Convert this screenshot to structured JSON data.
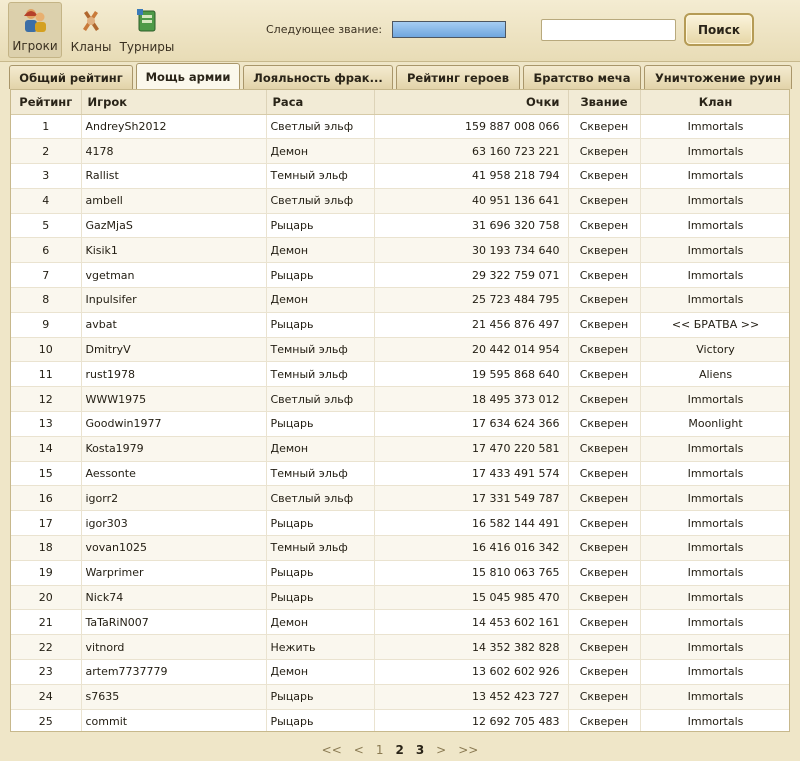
{
  "nav": {
    "players": "Игроки",
    "clans": "Кланы",
    "tournaments": "Турниры"
  },
  "rank": {
    "label": "Следующее звание:",
    "progress": 1.0
  },
  "search": {
    "value": "",
    "button": "Поиск"
  },
  "tabs": [
    "Общий рейтинг",
    "Мощь армии",
    "Лояльность фрак...",
    "Рейтинг героев",
    "Братство меча",
    "Уничтожение руин"
  ],
  "active_tab": 1,
  "columns": {
    "rank": "Рейтинг",
    "player": "Игрок",
    "race": "Раса",
    "points": "Очки",
    "title": "Звание",
    "clan": "Клан"
  },
  "rows": [
    [
      "1",
      "AndreySh2012",
      "Светлый эльф",
      "159 887 008 066",
      "Скверен",
      "Immortals"
    ],
    [
      "2",
      "4178",
      "Демон",
      "63 160 723 221",
      "Скверен",
      "Immortals"
    ],
    [
      "3",
      "Rallist",
      "Темный эльф",
      "41 958 218 794",
      "Скверен",
      "Immortals"
    ],
    [
      "4",
      "ambell",
      "Светлый эльф",
      "40 951 136 641",
      "Скверен",
      "Immortals"
    ],
    [
      "5",
      "GazMjaS",
      "Рыцарь",
      "31 696 320 758",
      "Скверен",
      "Immortals"
    ],
    [
      "6",
      "Kisik1",
      "Демон",
      "30 193 734 640",
      "Скверен",
      "Immortals"
    ],
    [
      "7",
      "vgetman",
      "Рыцарь",
      "29 322 759 071",
      "Скверен",
      "Immortals"
    ],
    [
      "8",
      "Inpulsifer",
      "Демон",
      "25 723 484 795",
      "Скверен",
      "Immortals"
    ],
    [
      "9",
      "avbat",
      "Рыцарь",
      "21 456 876 497",
      "Скверен",
      "<< БРАТВА >>"
    ],
    [
      "10",
      "DmitryV",
      "Темный эльф",
      "20 442 014 954",
      "Скверен",
      "Victory"
    ],
    [
      "11",
      "rust1978",
      "Темный эльф",
      "19 595 868 640",
      "Скверен",
      "Aliens"
    ],
    [
      "12",
      "WWW1975",
      "Светлый эльф",
      "18 495 373 012",
      "Скверен",
      "Immortals"
    ],
    [
      "13",
      "Goodwin1977",
      "Рыцарь",
      "17 634 624 366",
      "Скверен",
      "Moonlight"
    ],
    [
      "14",
      "Kosta1979",
      "Демон",
      "17 470 220 581",
      "Скверен",
      "Immortals"
    ],
    [
      "15",
      "Aessonte",
      "Темный эльф",
      "17 433 491 574",
      "Скверен",
      "Immortals"
    ],
    [
      "16",
      "igorr2",
      "Светлый эльф",
      "17 331 549 787",
      "Скверен",
      "Immortals"
    ],
    [
      "17",
      "igor303",
      "Рыцарь",
      "16 582 144 491",
      "Скверен",
      "Immortals"
    ],
    [
      "18",
      "vovan1025",
      "Темный эльф",
      "16 416 016 342",
      "Скверен",
      "Immortals"
    ],
    [
      "19",
      "Warprimer",
      "Рыцарь",
      "15 810 063 765",
      "Скверен",
      "Immortals"
    ],
    [
      "20",
      "Nick74",
      "Рыцарь",
      "15 045 985 470",
      "Скверен",
      "Immortals"
    ],
    [
      "21",
      "TaTaRiN007",
      "Демон",
      "14 453 602 161",
      "Скверен",
      "Immortals"
    ],
    [
      "22",
      "vitnord",
      "Нежить",
      "14 352 382 828",
      "Скверен",
      "Immortals"
    ],
    [
      "23",
      "artem7737779",
      "Демон",
      "13 602 602 926",
      "Скверен",
      "Immortals"
    ],
    [
      "24",
      "s7635",
      "Рыцарь",
      "13 452 423 727",
      "Скверен",
      "Immortals"
    ],
    [
      "25",
      "commit",
      "Рыцарь",
      "12 692 705 483",
      "Скверен",
      "Immortals"
    ]
  ],
  "pager": {
    "first": "<<",
    "prev": "<",
    "pages": [
      "1",
      "2",
      "3"
    ],
    "current": "1",
    "next": ">",
    "last": ">>"
  }
}
